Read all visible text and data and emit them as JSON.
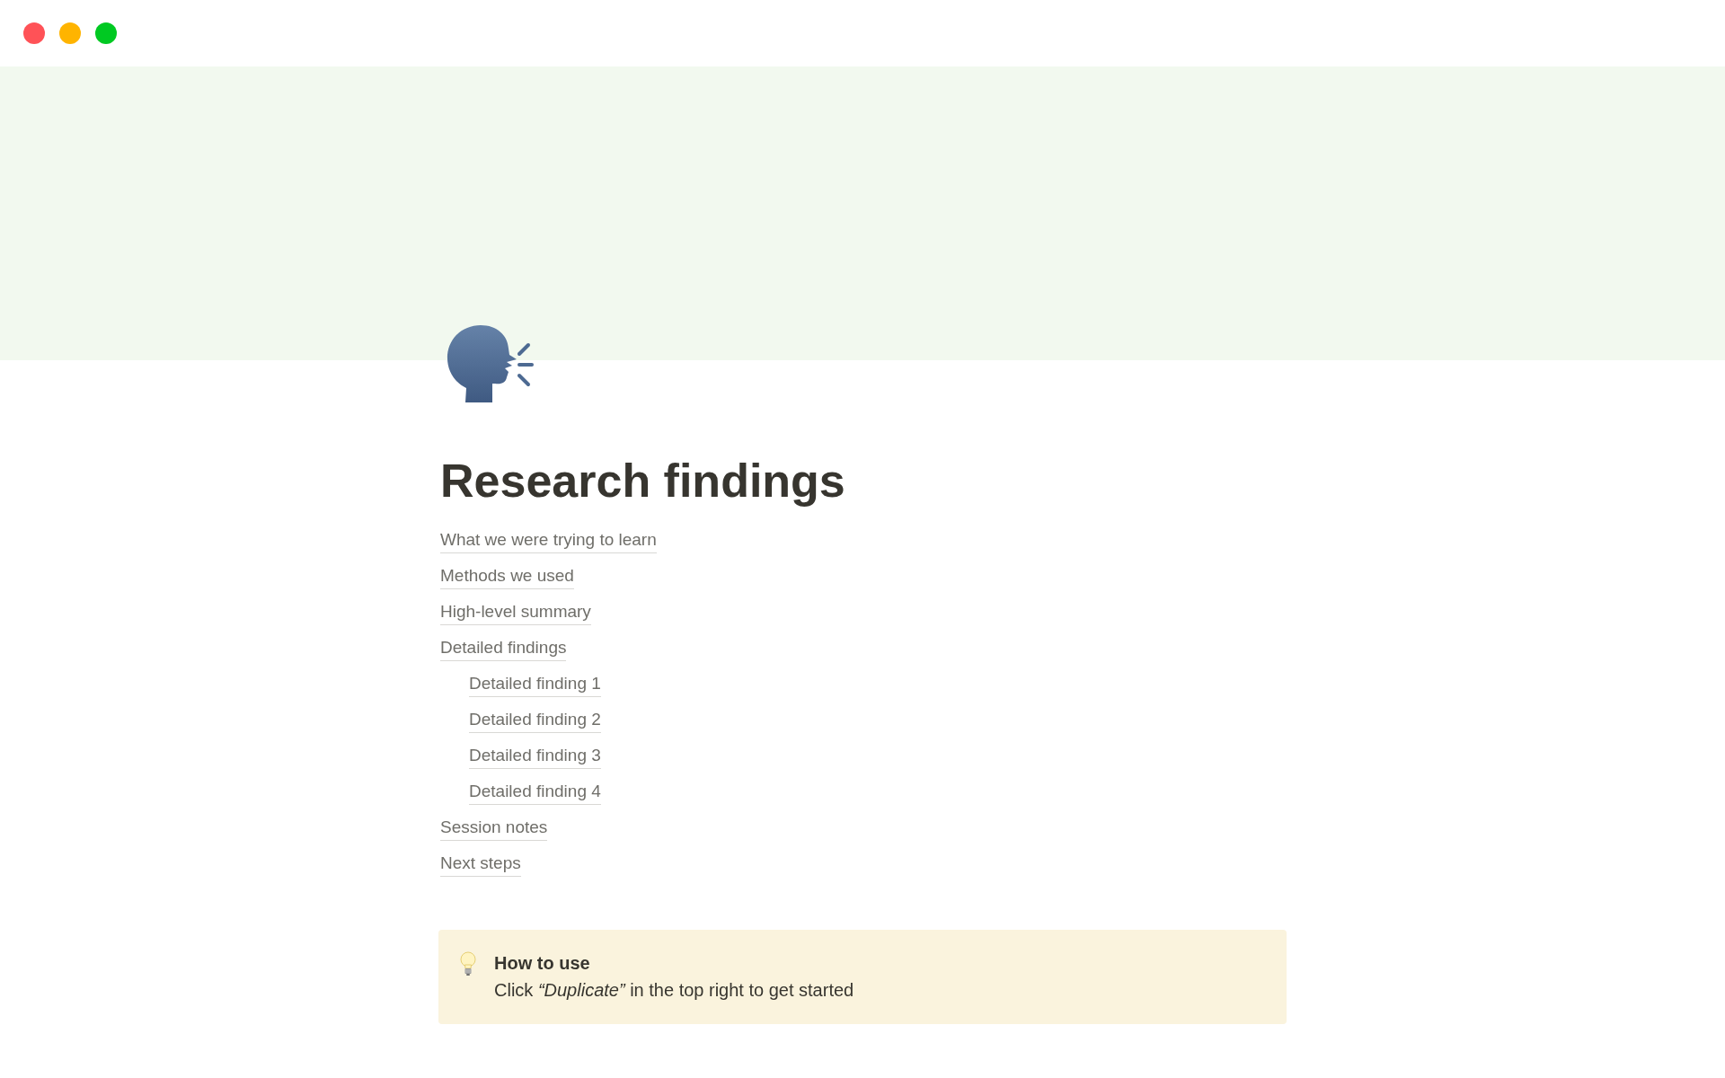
{
  "window_controls": [
    {
      "color": "#ff5257"
    },
    {
      "color": "#ffb400"
    },
    {
      "color": "#00c922"
    }
  ],
  "page": {
    "title": "Research findings",
    "contents": [
      {
        "label": "What we were trying to learn"
      },
      {
        "label": "Methods we used"
      },
      {
        "label": "High-level summary"
      },
      {
        "label": "Detailed findings",
        "children": [
          {
            "label": "Detailed finding 1"
          },
          {
            "label": "Detailed finding 2"
          },
          {
            "label": "Detailed finding 3"
          },
          {
            "label": "Detailed finding 4"
          }
        ]
      },
      {
        "label": "Session notes"
      },
      {
        "label": "Next steps"
      }
    ],
    "callout": {
      "heading": "How to use",
      "text": "Click *“Duplicate”* in the top right to get started"
    }
  }
}
